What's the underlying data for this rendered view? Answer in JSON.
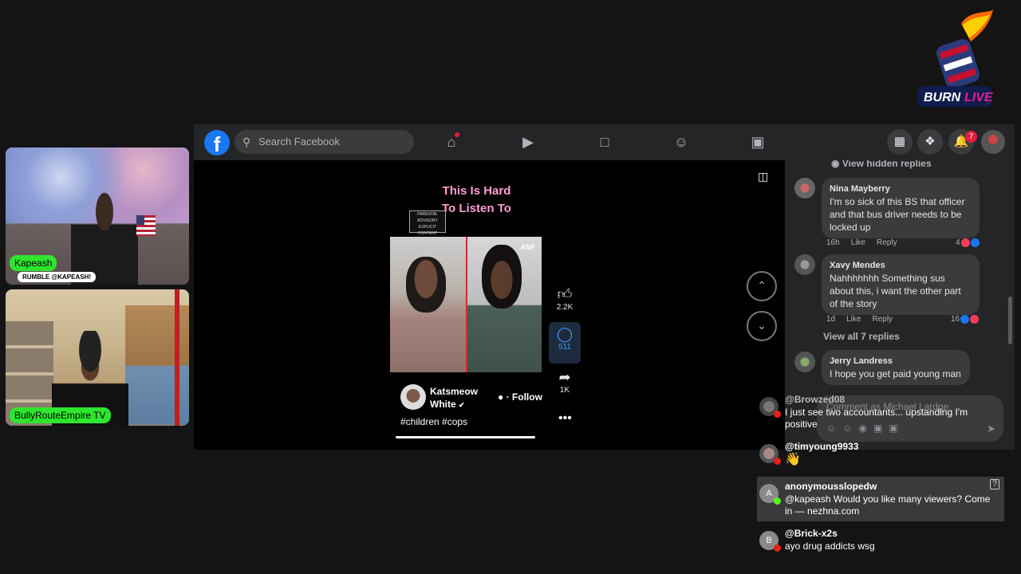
{
  "logo": {
    "text": "BURNLIVE"
  },
  "cams": [
    {
      "name": "Kapeash",
      "sub": "RUMBLE @KAPEASH!"
    },
    {
      "name": "BullyRouteEmpire TV"
    }
  ],
  "facebook": {
    "search_placeholder": "Search Facebook",
    "nav": [
      "home-icon",
      "video-icon",
      "marketplace-icon",
      "groups-icon",
      "gaming-icon"
    ],
    "notifications_count": "7"
  },
  "video": {
    "title_line1": "This Is Hard",
    "title_line2": "To Listen To",
    "advisory": "PARENTAL ADVISORY EXPLICIT CONTENT",
    "watermark": "ANF",
    "likes": "2.2K",
    "comments": "511",
    "shares": "1K",
    "author": "Katsmeow White",
    "follow": "· Follow",
    "tags": "#children #cops"
  },
  "comments": {
    "view_hidden": "View hidden replies",
    "items": [
      {
        "name": "Nina Mayberry",
        "text": "I'm so sick of this BS that officer and that bus driver needs to be locked up",
        "time": "16h",
        "like": "Like",
        "reply": "Reply",
        "reactions": "4"
      },
      {
        "name": "Xavy Mendes",
        "text": "Nahhhhhhh Something sus about this, i want the other part of the story",
        "time": "1d",
        "like": "Like",
        "reply": "Reply",
        "reactions": "16"
      },
      {
        "name": "Jerry Landress",
        "text": "I hope you get paid young man"
      }
    ],
    "view_all": "View all 7 replies",
    "composer_placeholder": "Comment as Michael Lardge"
  },
  "chat": [
    {
      "user": "@Browzed08",
      "text": "I just see two accountants... upstanding I'm positive",
      "platform": "youtube"
    },
    {
      "user": "@timyoung9933",
      "text": "👋",
      "platform": "youtube"
    },
    {
      "user": "anonymousslopedw",
      "text": "@kapeash Would you like many viewers? Come in — nezhna.com",
      "platform": "kick",
      "initial": "A"
    },
    {
      "user": "@Brick-x2s",
      "text": "ayo drug addicts wsg",
      "platform": "youtube",
      "initial": "B"
    }
  ]
}
